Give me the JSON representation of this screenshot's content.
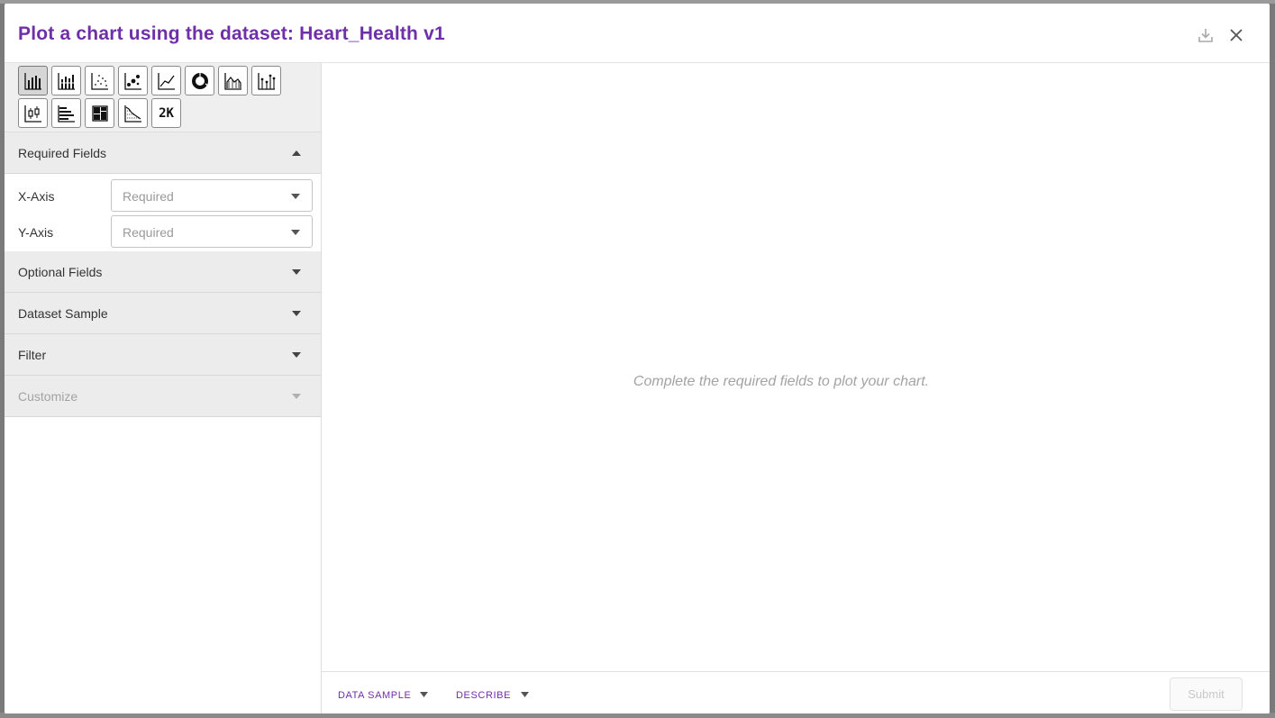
{
  "dialog": {
    "title": "Plot a chart using the dataset: Heart_Health v1",
    "icons": [
      "download-icon",
      "close-icon"
    ]
  },
  "chart_types": [
    {
      "name": "bar-chart",
      "icon": "bar-chart-icon",
      "active": true
    },
    {
      "name": "stacked-bar-chart",
      "icon": "stacked-bar-icon",
      "active": false
    },
    {
      "name": "scatter-chart",
      "icon": "scatter-icon",
      "active": false
    },
    {
      "name": "bubble-chart",
      "icon": "bubble-icon",
      "active": false
    },
    {
      "name": "line-chart",
      "icon": "line-icon",
      "active": false
    },
    {
      "name": "donut-chart",
      "icon": "donut-icon",
      "active": false
    },
    {
      "name": "area-chart",
      "icon": "area-icon",
      "active": false
    },
    {
      "name": "dot-plot",
      "icon": "dot-plot-icon",
      "active": false
    },
    {
      "name": "box-plot",
      "icon": "box-plot-icon",
      "active": false
    },
    {
      "name": "horizontal-bar-chart",
      "icon": "horizontal-bar-icon",
      "active": false
    },
    {
      "name": "treemap-chart",
      "icon": "treemap-icon",
      "active": false
    },
    {
      "name": "density-chart",
      "icon": "density-icon",
      "active": false
    },
    {
      "name": "kpi-chart",
      "icon": "kpi-icon",
      "active": false,
      "label": "2K"
    }
  ],
  "sections": {
    "required": {
      "label": "Required Fields",
      "expanded": true
    },
    "optional": {
      "label": "Optional Fields"
    },
    "sample": {
      "label": "Dataset Sample"
    },
    "filter": {
      "label": "Filter"
    },
    "customize": {
      "label": "Customize",
      "disabled": true
    }
  },
  "fields": {
    "x_axis": {
      "label": "X-Axis",
      "placeholder": "Required"
    },
    "y_axis": {
      "label": "Y-Axis",
      "placeholder": "Required"
    }
  },
  "main": {
    "message": "Complete the required fields to plot your chart."
  },
  "footer": {
    "data_sample": "DATA SAMPLE",
    "describe": "DESCRIBE",
    "submit": "Submit"
  }
}
